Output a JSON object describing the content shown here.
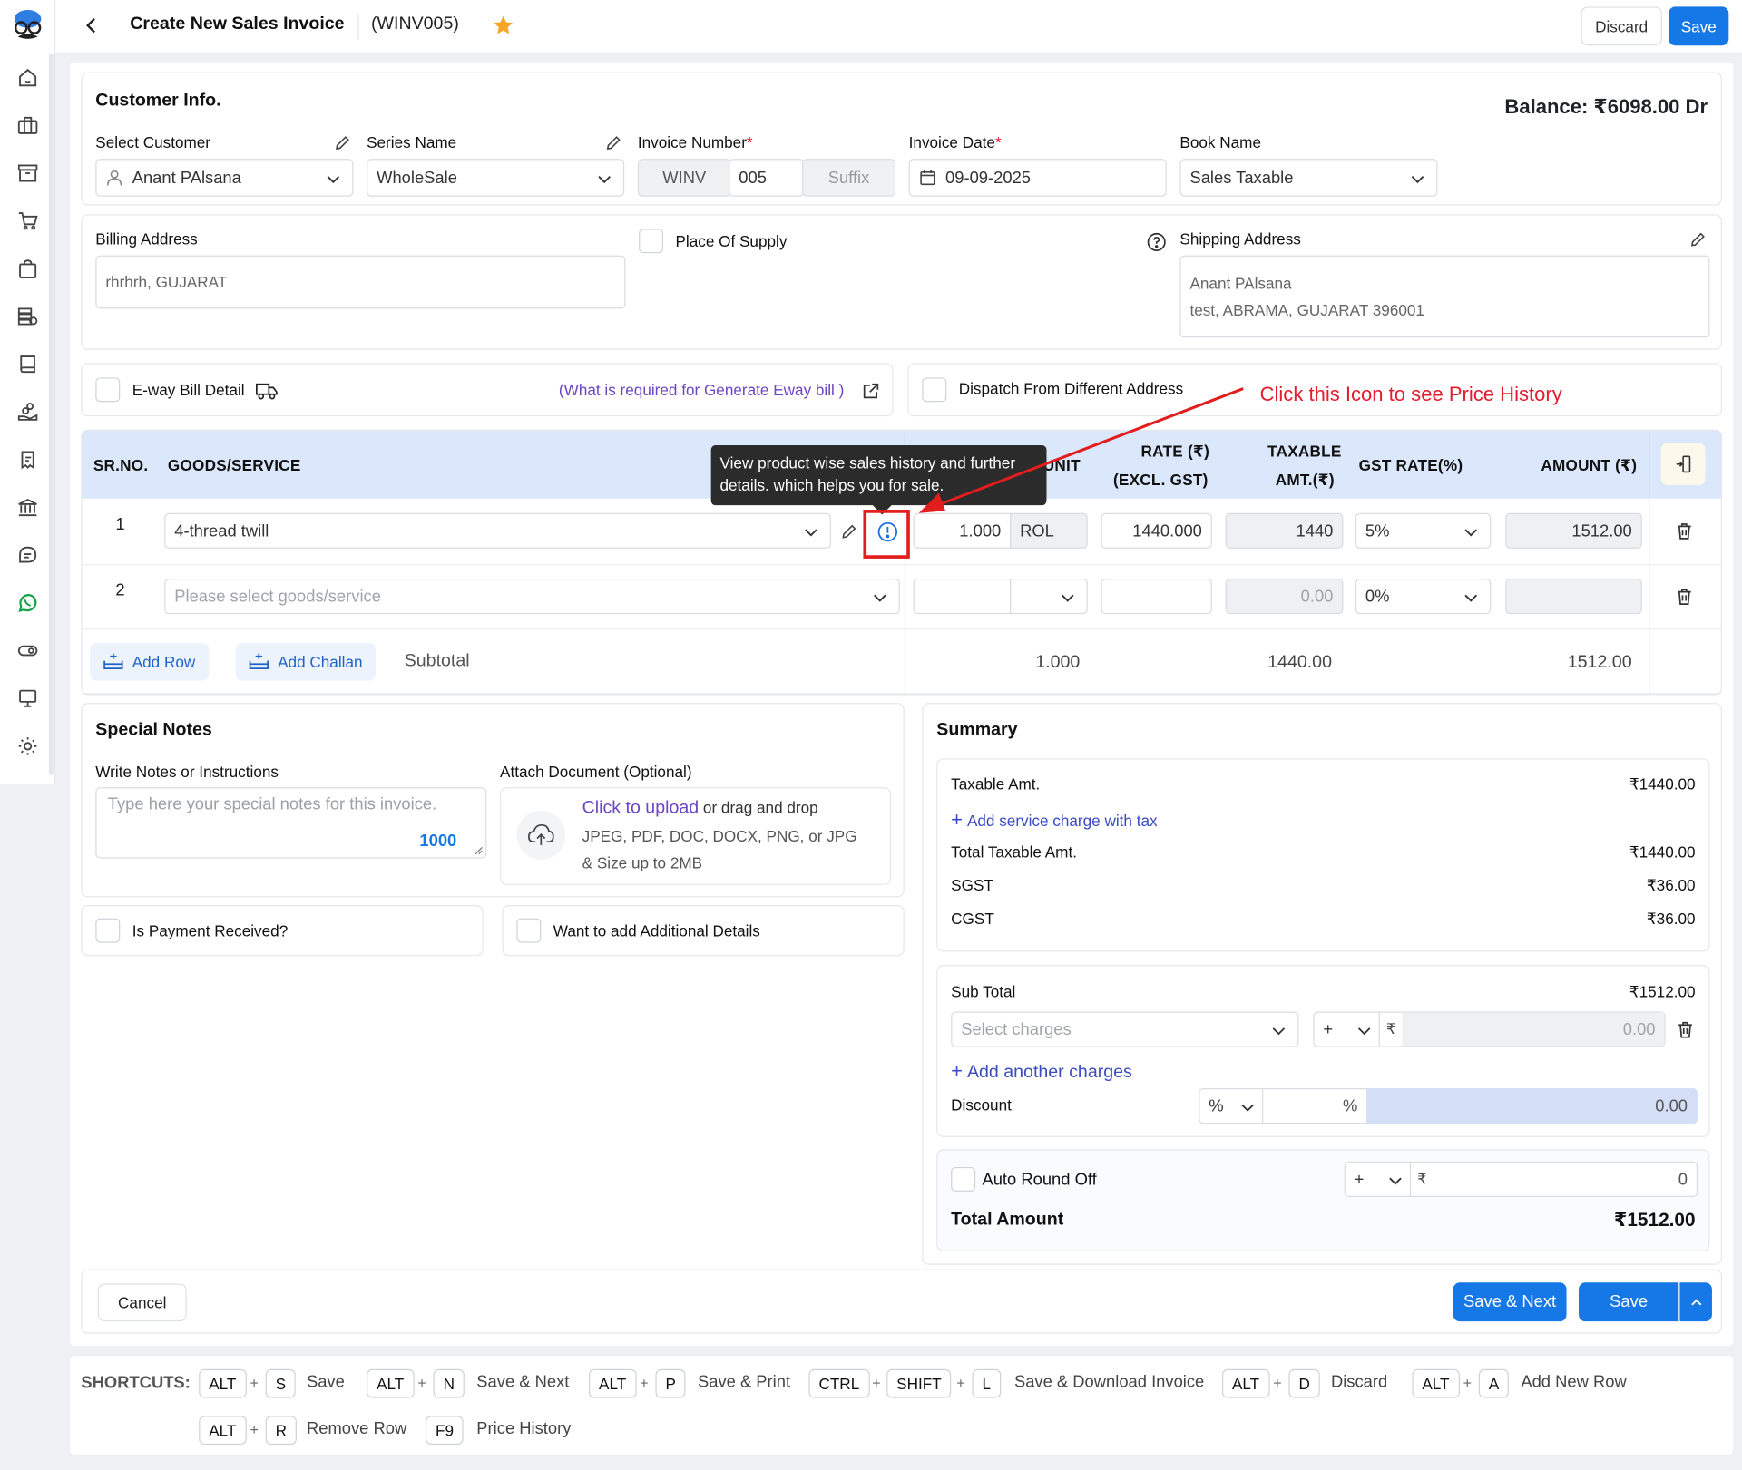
{
  "header": {
    "title": "Create New Sales Invoice",
    "code": "(WINV005)",
    "discard": "Discard",
    "save": "Save"
  },
  "customer": {
    "section_title": "Customer Info.",
    "balance": "Balance: ₹6098.00 Dr",
    "select_customer_label": "Select Customer",
    "select_customer_value": "Anant PAlsana",
    "series_label": "Series Name",
    "series_value": "WholeSale",
    "invoice_number_label": "Invoice Number",
    "invoice_prefix": "WINV",
    "invoice_number": "005",
    "invoice_suffix": "Suffix",
    "invoice_date_label": "Invoice Date",
    "invoice_date": "09-09-2025",
    "book_label": "Book Name",
    "book_value": "Sales Taxable"
  },
  "address": {
    "billing_label": "Billing Address",
    "billing_value": "rhrhrh, GUJARAT",
    "place_of_supply": "Place Of Supply",
    "shipping_label": "Shipping Address",
    "shipping_line1": "Anant PAlsana",
    "shipping_line2": "test, ABRAMA, GUJARAT 396001"
  },
  "eway": {
    "label": "E-way Bill Detail",
    "link": "(What is required for Generate Eway bill )",
    "dispatch": "Dispatch From Different Address"
  },
  "annotation": "Click this Icon to see Price History",
  "tooltip": "View product wise sales history and further details. which helps you for sale.",
  "table": {
    "headers": {
      "sr": "SR.NO.",
      "goods": "GOODS/SERVICE",
      "unit": "UNIT",
      "rate1": "RATE (₹)",
      "rate2": "(EXCL. GST)",
      "taxable1": "TAXABLE",
      "taxable2": "AMT.(₹)",
      "gst": "GST RATE(%)",
      "amount": "AMOUNT (₹)"
    },
    "rows": [
      {
        "sr": "1",
        "goods": "4-thread twill",
        "qty": "1.000",
        "unit": "ROL",
        "rate": "1440.000",
        "taxable": "1440",
        "gst": "5%",
        "amount": "1512.00"
      },
      {
        "sr": "2",
        "goods": "Please select goods/service",
        "qty": "",
        "unit": "",
        "rate": "",
        "taxable": "0.00",
        "gst": "0%",
        "amount": ""
      }
    ],
    "add_row": "Add Row",
    "add_challan": "Add Challan",
    "subtotal_label": "Subtotal",
    "subtotal_qty": "1.000",
    "subtotal_taxable": "1440.00",
    "subtotal_amount": "1512.00"
  },
  "notes": {
    "title": "Special Notes",
    "write_label": "Write Notes or Instructions",
    "placeholder": "Type here your special notes for this invoice.",
    "count": "1000",
    "attach_label": "Attach Document (Optional)",
    "upload_link": "Click to upload",
    "upload_rest": " or drag and drop",
    "formats": "JPEG, PDF, DOC, DOCX, PNG, or JPG",
    "size": "& Size up to 2MB",
    "payment": "Is Payment Received?",
    "additional": "Want to add Additional Details"
  },
  "summary": {
    "title": "Summary",
    "taxable_label": "Taxable Amt.",
    "taxable_value": "₹1440.00",
    "add_service": "Add service charge with tax",
    "total_taxable_label": "Total Taxable Amt.",
    "total_taxable_value": "₹1440.00",
    "sgst_label": "SGST",
    "sgst_value": "₹36.00",
    "cgst_label": "CGST",
    "cgst_value": "₹36.00",
    "subtotal_label": "Sub Total",
    "subtotal_value": "₹1512.00",
    "select_charges": "Select charges",
    "charge_sign": "+",
    "rupee": "₹",
    "charge_value": "0.00",
    "add_another": "Add another charges",
    "discount_label": "Discount",
    "discount_type": "%",
    "discount_pct": "%",
    "discount_value": "0.00",
    "round_off": "Auto Round Off",
    "round_sign": "+",
    "round_value": "0",
    "total_label": "Total Amount",
    "total_value": "₹1512.00"
  },
  "footer": {
    "cancel": "Cancel",
    "save_next": "Save & Next",
    "save": "Save"
  },
  "shortcuts": {
    "label": "SHORTCUTS:",
    "items": [
      {
        "k1": "ALT",
        "k2": "S",
        "desc": "Save"
      },
      {
        "k1": "ALT",
        "k2": "N",
        "desc": "Save & Next"
      },
      {
        "k1": "ALT",
        "k2": "P",
        "desc": "Save & Print"
      },
      {
        "k1": "CTRL",
        "k2": "SHIFT",
        "k3": "L",
        "desc": "Save & Download Invoice"
      },
      {
        "k1": "ALT",
        "k2": "D",
        "desc": "Discard"
      },
      {
        "k1": "ALT",
        "k2": "A",
        "desc": "Add New Row"
      },
      {
        "k1": "ALT",
        "k2": "R",
        "desc": "Remove Row"
      },
      {
        "k1": "F9",
        "desc": "Price History"
      }
    ],
    "plus": "+"
  }
}
